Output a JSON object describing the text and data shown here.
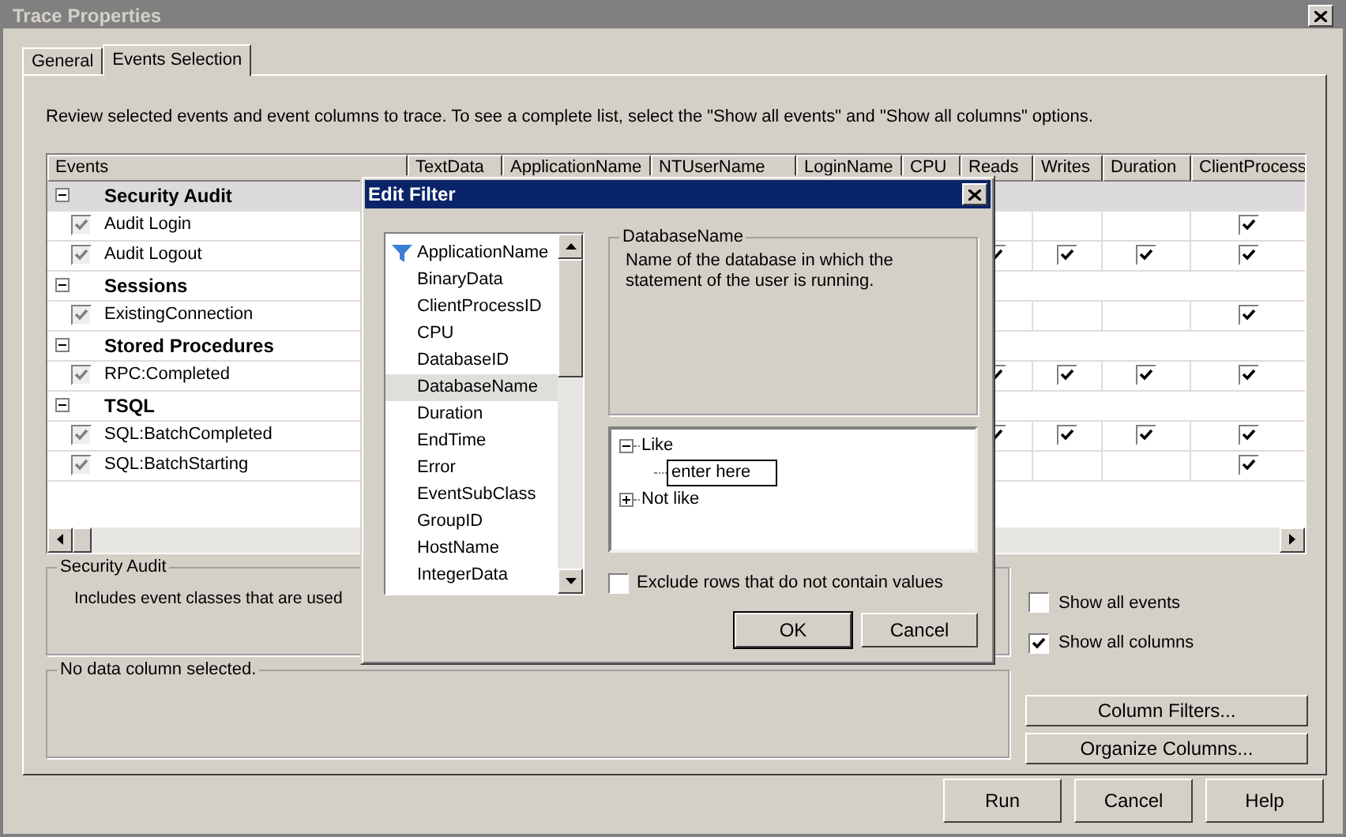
{
  "window": {
    "title": "Trace Properties"
  },
  "tabs": [
    {
      "label": "General",
      "selected": false
    },
    {
      "label": "Events Selection",
      "selected": true
    }
  ],
  "intro": "Review selected events and event columns to trace. To see a complete list, select the \"Show all events\" and \"Show all columns\" options.",
  "grid": {
    "columns": [
      "Events",
      "TextData",
      "ApplicationName",
      "NTUserName",
      "LoginName",
      "CPU",
      "Reads",
      "Writes",
      "Duration",
      "ClientProcess"
    ],
    "rows": [
      {
        "kind": "category",
        "name": "Security Audit",
        "expanded": true,
        "selected": true
      },
      {
        "kind": "event",
        "name": "Audit Login",
        "checked": true,
        "marks": [
          false,
          false,
          false,
          true
        ]
      },
      {
        "kind": "event",
        "name": "Audit Logout",
        "checked": true,
        "marks": [
          true,
          true,
          true,
          true
        ]
      },
      {
        "kind": "category",
        "name": "Sessions",
        "expanded": true,
        "selected": false
      },
      {
        "kind": "event",
        "name": "ExistingConnection",
        "checked": true,
        "marks": [
          false,
          false,
          false,
          true
        ]
      },
      {
        "kind": "category",
        "name": "Stored Procedures",
        "expanded": true,
        "selected": false
      },
      {
        "kind": "event",
        "name": "RPC:Completed",
        "checked": true,
        "marks": [
          true,
          true,
          true,
          true
        ]
      },
      {
        "kind": "category",
        "name": "TSQL",
        "expanded": true,
        "selected": false
      },
      {
        "kind": "event",
        "name": "SQL:BatchCompleted",
        "checked": true,
        "marks": [
          true,
          true,
          true,
          true
        ]
      },
      {
        "kind": "event",
        "name": "SQL:BatchStarting",
        "checked": true,
        "marks": [
          false,
          false,
          false,
          true
        ]
      }
    ]
  },
  "event_group": {
    "title": "Security Audit",
    "text": "Includes event classes that are used"
  },
  "column_group": {
    "title": "No data column selected."
  },
  "options": [
    {
      "label": "Show all events",
      "checked": false
    },
    {
      "label": "Show all columns",
      "checked": true
    }
  ],
  "side_buttons": [
    "Column Filters...",
    "Organize Columns..."
  ],
  "buttons": [
    "Run",
    "Cancel",
    "Help"
  ],
  "dialog": {
    "title": "Edit Filter",
    "columns": [
      {
        "label": "ApplicationName",
        "filtered": true,
        "selected": false
      },
      {
        "label": "BinaryData",
        "filtered": false,
        "selected": false
      },
      {
        "label": "ClientProcessID",
        "filtered": false,
        "selected": false
      },
      {
        "label": "CPU",
        "filtered": false,
        "selected": false
      },
      {
        "label": "DatabaseID",
        "filtered": false,
        "selected": false
      },
      {
        "label": "DatabaseName",
        "filtered": false,
        "selected": true
      },
      {
        "label": "Duration",
        "filtered": false,
        "selected": false
      },
      {
        "label": "EndTime",
        "filtered": false,
        "selected": false
      },
      {
        "label": "Error",
        "filtered": false,
        "selected": false
      },
      {
        "label": "EventSubClass",
        "filtered": false,
        "selected": false
      },
      {
        "label": "GroupID",
        "filtered": false,
        "selected": false
      },
      {
        "label": "HostName",
        "filtered": false,
        "selected": false
      },
      {
        "label": "IntegerData",
        "filtered": false,
        "selected": false
      }
    ],
    "description": {
      "title": "DatabaseName",
      "text": "Name of the database in which the statement of the user is running."
    },
    "operators": [
      {
        "label": "Like",
        "expanded": true,
        "children": [
          {
            "value": "enter here"
          }
        ]
      },
      {
        "label": "Not like",
        "expanded": false
      }
    ],
    "exclude": {
      "label": "Exclude rows that do not contain values",
      "checked": false
    },
    "buttons": [
      "OK",
      "Cancel"
    ]
  }
}
